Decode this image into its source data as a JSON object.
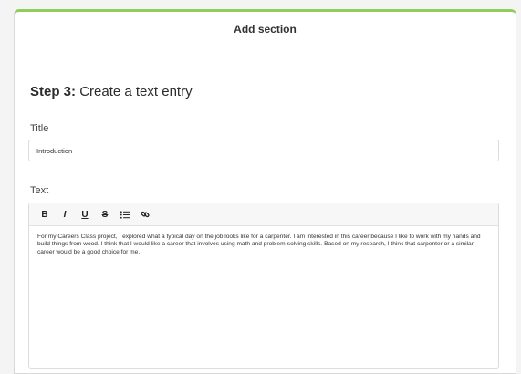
{
  "modal": {
    "title": "Add section"
  },
  "step": {
    "number_label": "Step 3:",
    "description": "Create a text entry"
  },
  "title_field": {
    "label": "Title",
    "value": "Introduction"
  },
  "text_field": {
    "label": "Text",
    "toolbar": [
      {
        "name": "bold-button",
        "glyph": "B"
      },
      {
        "name": "italic-button",
        "glyph": "I"
      },
      {
        "name": "underline-button",
        "glyph": "U"
      },
      {
        "name": "strikethrough-button",
        "glyph": "S"
      }
    ],
    "toolbar_icons": [
      "bulleted-list-icon",
      "link-icon"
    ],
    "content": "For my Careers Class project, I explored what a typical day on the job looks like for a carpenter. I am interested in this career because I like to work with my hands and build things from wood. I think that I would like a career that involves using math and problem-solving skills. Based on my research, I think that carpenter or a similar career would be a good choice for me."
  },
  "colors": {
    "accent": "#8fce5b"
  }
}
